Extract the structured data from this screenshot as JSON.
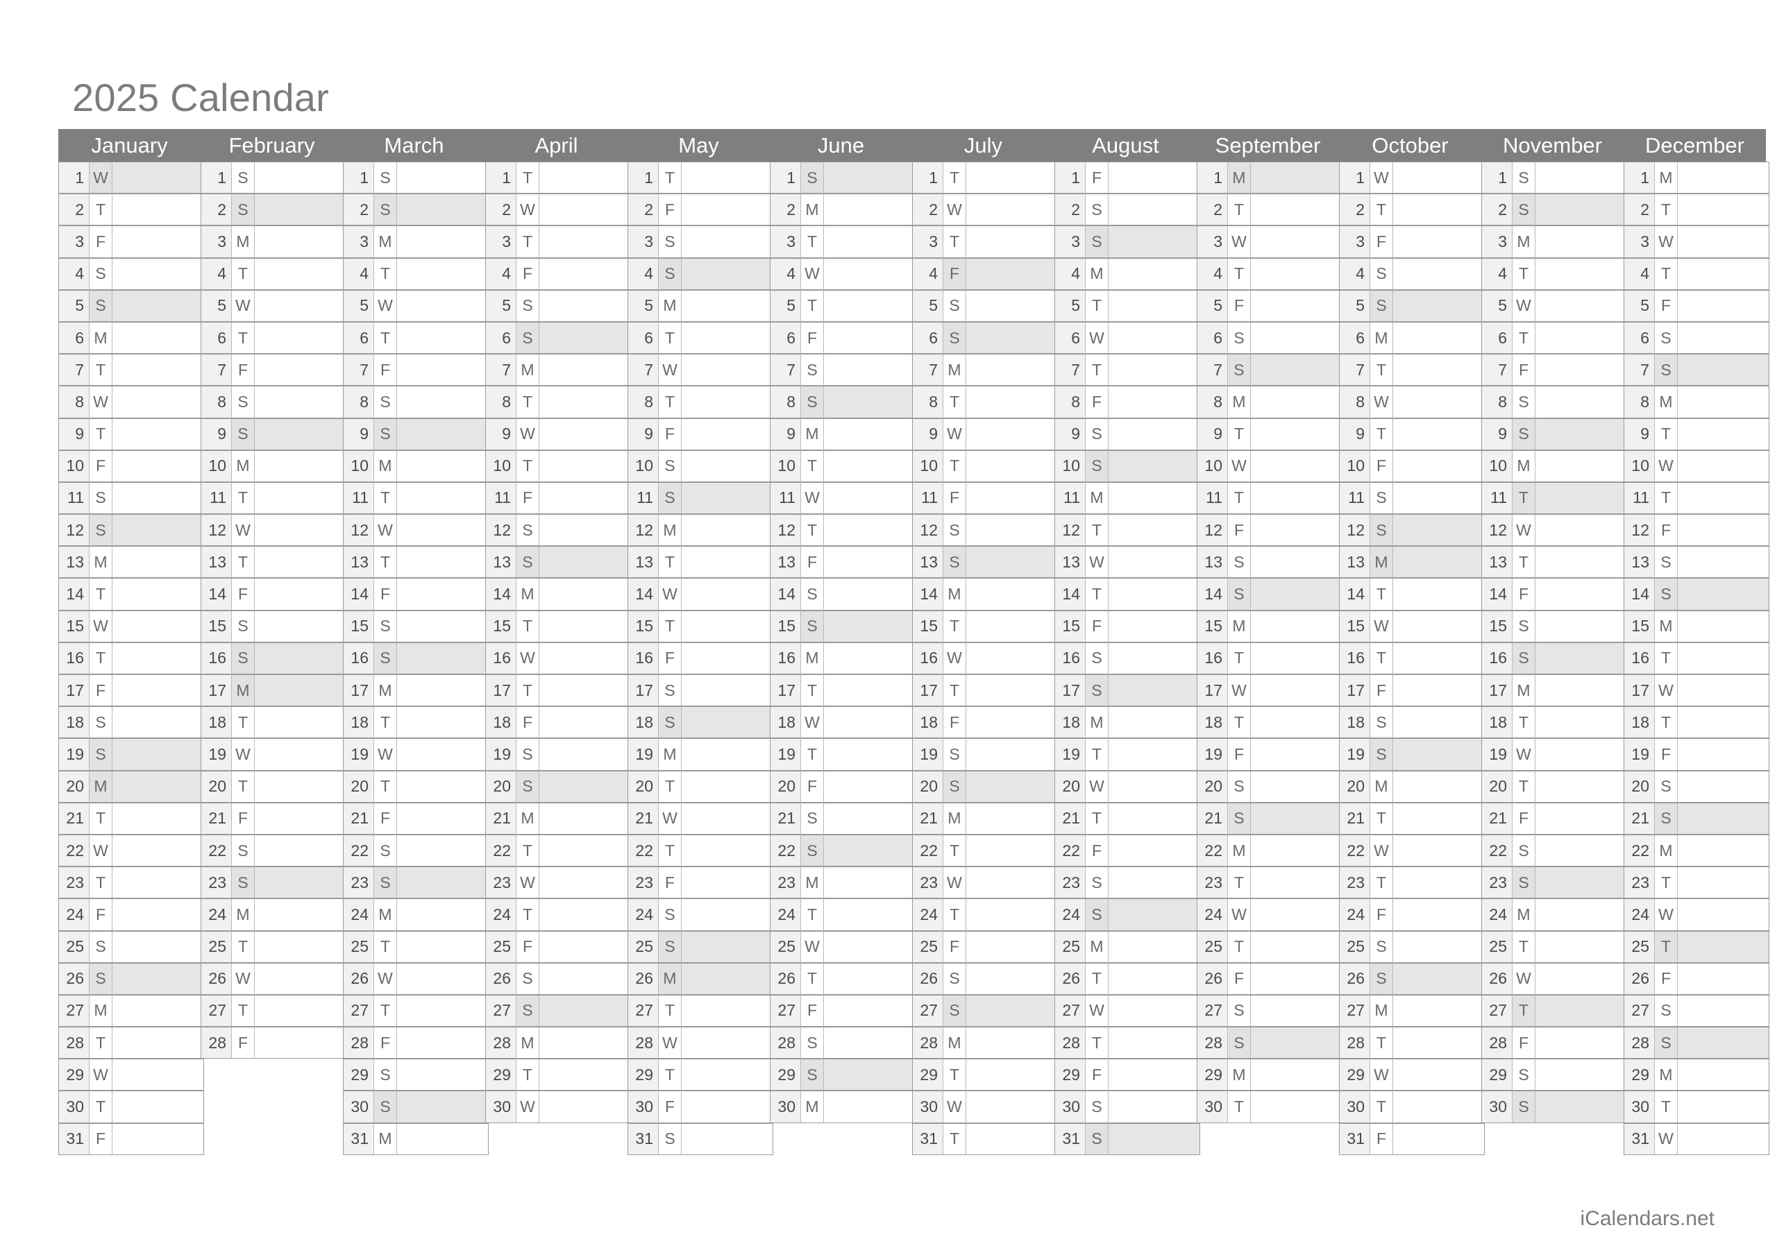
{
  "title": "2025 Calendar",
  "year": 2025,
  "footer": "iCalendars.net",
  "colors": {
    "header_bg": "#7f7f7f",
    "header_text": "#ffffff",
    "title_text": "#7c7c7c",
    "day_number_bg": "#f1f1f1",
    "highlight_bg": "#e2e2e2",
    "note_highlight_bg": "#e6e6e6",
    "cell_border": "#9a9a9a",
    "text": "#4a4a4a",
    "footer_text": "#7c7c7c"
  },
  "weekday_letters": {
    "Sunday": "S",
    "Monday": "M",
    "Tuesday": "T",
    "Wednesday": "W",
    "Thursday": "T",
    "Friday": "F",
    "Saturday": "S"
  },
  "highlight_rule": "Sundays and US federal holidays are shaded",
  "months": [
    {
      "name": "January",
      "index": 1,
      "days": 31,
      "first_weekday": "Wednesday",
      "dow": [
        "W",
        "T",
        "F",
        "S",
        "S",
        "M",
        "T",
        "W",
        "T",
        "F",
        "S",
        "S",
        "M",
        "T",
        "W",
        "T",
        "F",
        "S",
        "S",
        "M",
        "T",
        "W",
        "T",
        "F",
        "S",
        "S",
        "M",
        "T",
        "W",
        "T",
        "F"
      ],
      "highlighted": [
        1,
        5,
        12,
        19,
        20,
        26
      ]
    },
    {
      "name": "February",
      "index": 2,
      "days": 28,
      "first_weekday": "Saturday",
      "dow": [
        "S",
        "S",
        "M",
        "T",
        "W",
        "T",
        "F",
        "S",
        "S",
        "M",
        "T",
        "W",
        "T",
        "F",
        "S",
        "S",
        "M",
        "T",
        "W",
        "T",
        "F",
        "S",
        "S",
        "M",
        "T",
        "W",
        "T",
        "F"
      ],
      "highlighted": [
        2,
        9,
        16,
        17,
        23
      ]
    },
    {
      "name": "March",
      "index": 3,
      "days": 31,
      "first_weekday": "Saturday",
      "dow": [
        "S",
        "S",
        "M",
        "T",
        "W",
        "T",
        "F",
        "S",
        "S",
        "M",
        "T",
        "W",
        "T",
        "F",
        "S",
        "S",
        "M",
        "T",
        "W",
        "T",
        "F",
        "S",
        "S",
        "M",
        "T",
        "W",
        "T",
        "F",
        "S",
        "S",
        "M"
      ],
      "highlighted": [
        2,
        9,
        16,
        23,
        30
      ]
    },
    {
      "name": "April",
      "index": 4,
      "days": 30,
      "first_weekday": "Tuesday",
      "dow": [
        "T",
        "W",
        "T",
        "F",
        "S",
        "S",
        "M",
        "T",
        "W",
        "T",
        "F",
        "S",
        "S",
        "M",
        "T",
        "W",
        "T",
        "F",
        "S",
        "S",
        "M",
        "T",
        "W",
        "T",
        "F",
        "S",
        "S",
        "M",
        "T",
        "W"
      ],
      "highlighted": [
        6,
        13,
        20,
        27
      ]
    },
    {
      "name": "May",
      "index": 5,
      "days": 31,
      "first_weekday": "Thursday",
      "dow": [
        "T",
        "F",
        "S",
        "S",
        "M",
        "T",
        "W",
        "T",
        "F",
        "S",
        "S",
        "M",
        "T",
        "W",
        "T",
        "F",
        "S",
        "S",
        "M",
        "T",
        "W",
        "T",
        "F",
        "S",
        "S",
        "M",
        "T",
        "W",
        "T",
        "F",
        "S"
      ],
      "highlighted": [
        4,
        11,
        18,
        25,
        26
      ]
    },
    {
      "name": "June",
      "index": 6,
      "days": 30,
      "first_weekday": "Sunday",
      "dow": [
        "S",
        "M",
        "T",
        "W",
        "T",
        "F",
        "S",
        "S",
        "M",
        "T",
        "W",
        "T",
        "F",
        "S",
        "S",
        "M",
        "T",
        "W",
        "T",
        "F",
        "S",
        "S",
        "M",
        "T",
        "W",
        "T",
        "F",
        "S",
        "S",
        "M"
      ],
      "highlighted": [
        1,
        8,
        15,
        22,
        29
      ]
    },
    {
      "name": "July",
      "index": 7,
      "days": 31,
      "first_weekday": "Tuesday",
      "dow": [
        "T",
        "W",
        "T",
        "F",
        "S",
        "S",
        "M",
        "T",
        "W",
        "T",
        "F",
        "S",
        "S",
        "M",
        "T",
        "W",
        "T",
        "F",
        "S",
        "S",
        "M",
        "T",
        "W",
        "T",
        "F",
        "S",
        "S",
        "M",
        "T",
        "W",
        "T"
      ],
      "highlighted": [
        4,
        6,
        13,
        20,
        27
      ]
    },
    {
      "name": "August",
      "index": 8,
      "days": 31,
      "first_weekday": "Friday",
      "dow": [
        "F",
        "S",
        "S",
        "M",
        "T",
        "W",
        "T",
        "F",
        "S",
        "S",
        "M",
        "T",
        "W",
        "T",
        "F",
        "S",
        "S",
        "M",
        "T",
        "W",
        "T",
        "F",
        "S",
        "S",
        "M",
        "T",
        "W",
        "T",
        "F",
        "S",
        "S"
      ],
      "highlighted": [
        3,
        10,
        17,
        24,
        31
      ]
    },
    {
      "name": "September",
      "index": 9,
      "days": 30,
      "first_weekday": "Monday",
      "dow": [
        "M",
        "T",
        "W",
        "T",
        "F",
        "S",
        "S",
        "M",
        "T",
        "W",
        "T",
        "F",
        "S",
        "S",
        "M",
        "T",
        "W",
        "T",
        "F",
        "S",
        "S",
        "M",
        "T",
        "W",
        "T",
        "F",
        "S",
        "S",
        "M",
        "T"
      ],
      "highlighted": [
        1,
        7,
        14,
        21,
        28
      ]
    },
    {
      "name": "October",
      "index": 10,
      "days": 31,
      "first_weekday": "Wednesday",
      "dow": [
        "W",
        "T",
        "F",
        "S",
        "S",
        "M",
        "T",
        "W",
        "T",
        "F",
        "S",
        "S",
        "M",
        "T",
        "W",
        "T",
        "F",
        "S",
        "S",
        "M",
        "T",
        "W",
        "T",
        "F",
        "S",
        "S",
        "M",
        "T",
        "W",
        "T",
        "F"
      ],
      "highlighted": [
        5,
        12,
        13,
        19,
        26
      ]
    },
    {
      "name": "November",
      "index": 11,
      "days": 30,
      "first_weekday": "Saturday",
      "dow": [
        "S",
        "S",
        "M",
        "T",
        "W",
        "T",
        "F",
        "S",
        "S",
        "M",
        "T",
        "W",
        "T",
        "F",
        "S",
        "S",
        "M",
        "T",
        "W",
        "T",
        "F",
        "S",
        "S",
        "M",
        "T",
        "W",
        "T",
        "F",
        "S",
        "S"
      ],
      "highlighted": [
        2,
        9,
        11,
        16,
        23,
        27,
        30
      ]
    },
    {
      "name": "December",
      "index": 12,
      "days": 31,
      "first_weekday": "Monday",
      "dow": [
        "M",
        "T",
        "W",
        "T",
        "F",
        "S",
        "S",
        "M",
        "T",
        "W",
        "T",
        "F",
        "S",
        "S",
        "M",
        "T",
        "W",
        "T",
        "F",
        "S",
        "S",
        "M",
        "T",
        "W",
        "T",
        "F",
        "S",
        "S",
        "M",
        "T",
        "W"
      ],
      "highlighted": [
        7,
        14,
        21,
        25,
        28
      ]
    }
  ]
}
